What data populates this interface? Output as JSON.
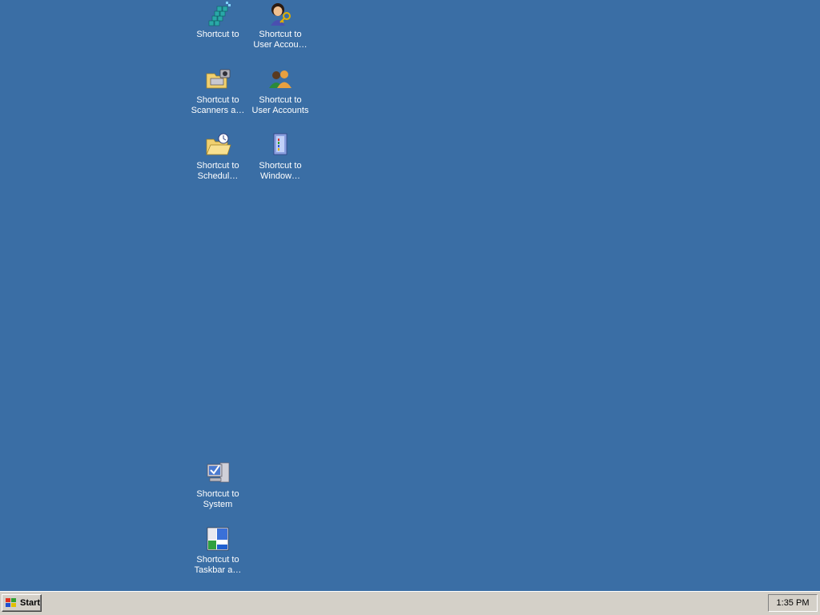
{
  "desktop": {
    "background_color": "#3a6ea5",
    "icons": [
      {
        "label": "Shortcut to",
        "icon": "registry-icon"
      },
      {
        "label": "Shortcut to\nUser Accou…",
        "icon": "user-key-icon"
      },
      {
        "label": "Shortcut to\nScanners a…",
        "icon": "scanner-camera-icon"
      },
      {
        "label": "Shortcut to\nUser Accounts",
        "icon": "users-icon"
      },
      {
        "label": "Shortcut to\nSchedul…",
        "icon": "scheduled-tasks-folder-icon"
      },
      {
        "label": "Shortcut to\nWindow…",
        "icon": "windows-components-icon"
      },
      {
        "label": "Shortcut to\nSystem",
        "icon": "system-computer-icon"
      },
      {
        "label": "Shortcut to\nTaskbar a…",
        "icon": "taskbar-start-menu-icon"
      }
    ]
  },
  "taskbar": {
    "start_label": "Start",
    "clock": "1:35 PM"
  }
}
